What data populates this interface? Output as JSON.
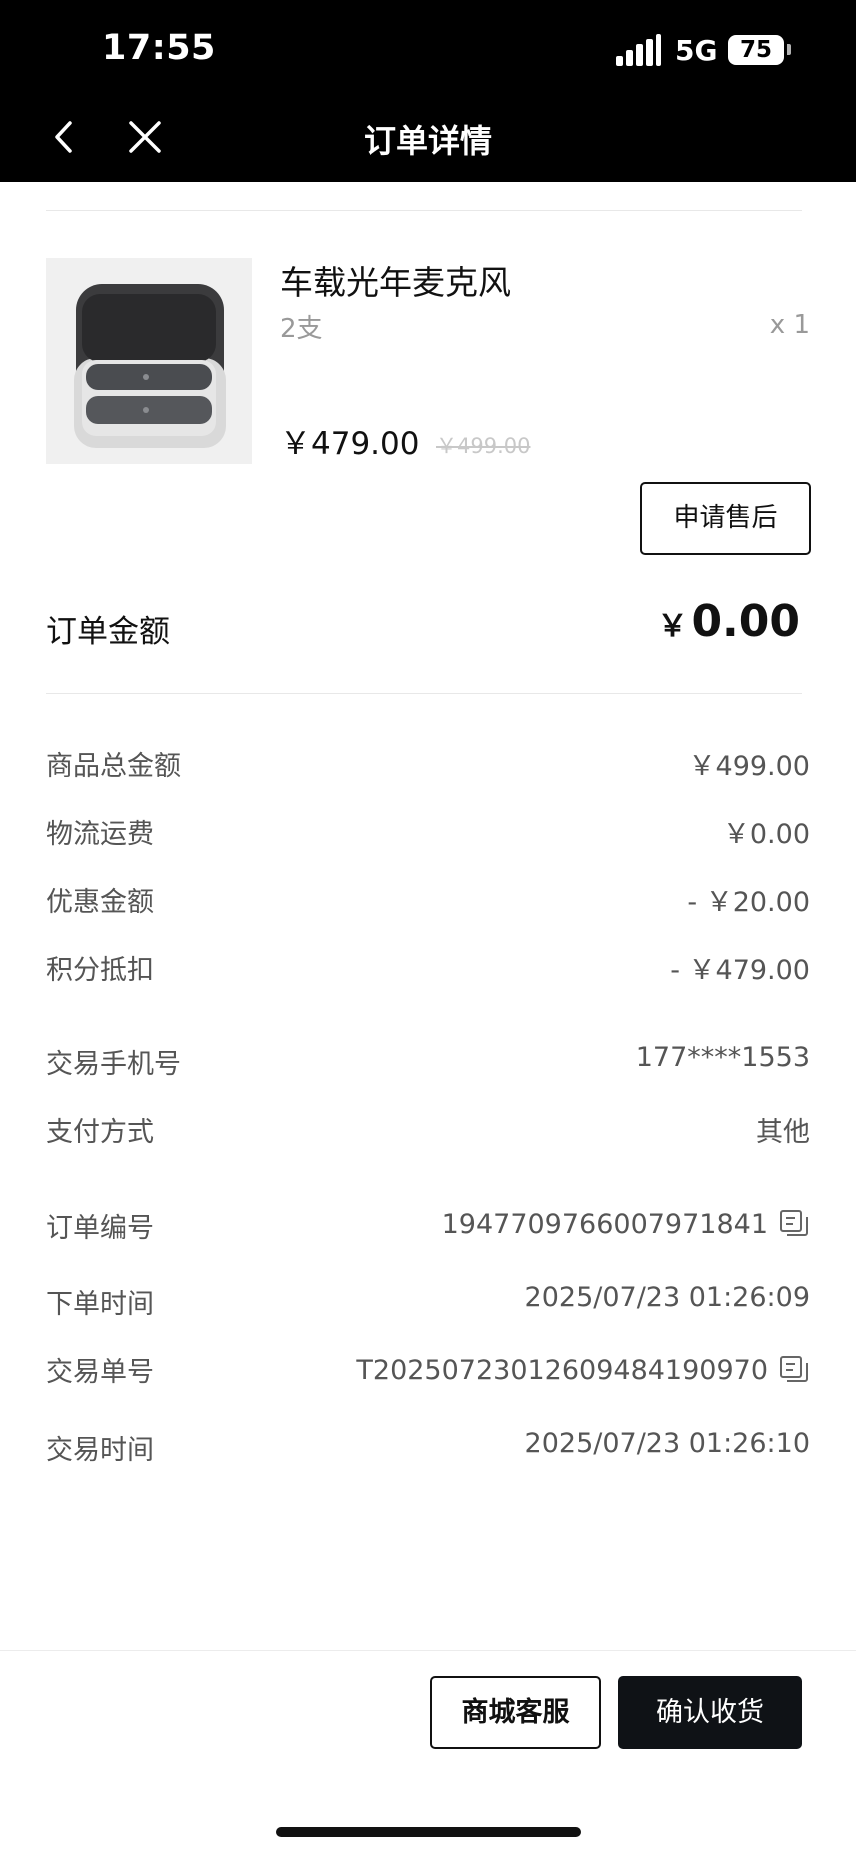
{
  "status_bar": {
    "time": "17:55",
    "network": "5G",
    "battery": "75"
  },
  "nav": {
    "title": "订单详情"
  },
  "product": {
    "name": "车载光年麦克风",
    "spec": "2支",
    "quantity": "x 1",
    "price": "￥479.00",
    "original_price": "￥499.00",
    "aftersale_label": "申请售后"
  },
  "order_amount": {
    "label": "订单金额",
    "currency": "￥",
    "value": "0.00"
  },
  "cost_rows": [
    {
      "label": "商品总金额",
      "value": "￥499.00"
    },
    {
      "label": "物流运费",
      "value": "￥0.00"
    },
    {
      "label": "优惠金额",
      "value": "- ￥20.00"
    },
    {
      "label": "积分抵扣",
      "value": "- ￥479.00"
    }
  ],
  "payment_rows": [
    {
      "label": "交易手机号",
      "value": "177****1553"
    },
    {
      "label": "支付方式",
      "value": "其他"
    }
  ],
  "order_rows": [
    {
      "label": "订单编号",
      "value": "1947709766007971841",
      "copyable": true
    },
    {
      "label": "下单时间",
      "value": "2025/07/23 01:26:09",
      "copyable": false
    },
    {
      "label": "交易单号",
      "value": "T2025072301260948419 0970",
      "copyable": true
    },
    {
      "label": "交易时间",
      "value": "2025/07/23 01:26:10",
      "copyable": false
    }
  ],
  "bottom": {
    "service_label": "商城客服",
    "confirm_label": "确认收货"
  },
  "icons": [
    "back-icon",
    "close-icon",
    "copy-icon"
  ],
  "colors": {
    "header_bg": "#000000",
    "confirm_bg": "#0f1216",
    "muted_text": "#999999"
  }
}
